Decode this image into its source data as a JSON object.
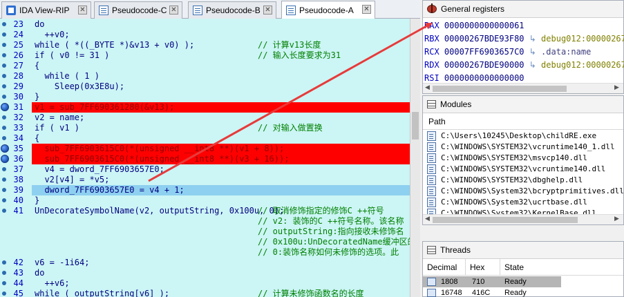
{
  "tabs": [
    {
      "label": "IDA View-RIP",
      "icon": "ida-icon",
      "active": false
    },
    {
      "label": "Pseudocode-C",
      "icon": "document-icon",
      "active": false
    },
    {
      "label": "Pseudocode-B",
      "icon": "document-icon",
      "active": false
    },
    {
      "label": "Pseudocode-A",
      "icon": "document-icon",
      "active": true
    }
  ],
  "code_lines": [
    {
      "num": "23",
      "text": "do",
      "comment": "",
      "state": "normal"
    },
    {
      "num": "24",
      "text": "  ++v0;",
      "comment": "",
      "state": "normal"
    },
    {
      "num": "25",
      "text": "while ( *((_BYTE *)&v13 + v0) );",
      "comment": "// 计算v13长度",
      "state": "normal"
    },
    {
      "num": "26",
      "text": "if ( v0 != 31 )",
      "comment": "// 输入长度要求为31",
      "state": "normal"
    },
    {
      "num": "27",
      "text": "{",
      "comment": "",
      "state": "normal"
    },
    {
      "num": "28",
      "text": "  while ( 1 )",
      "comment": "",
      "state": "normal"
    },
    {
      "num": "29",
      "text": "    Sleep(0x3E8u);",
      "comment": "",
      "state": "normal"
    },
    {
      "num": "30",
      "text": "}",
      "comment": "",
      "state": "normal"
    },
    {
      "num": "31",
      "text": "v1 = sub_7FF690361280(&v13);",
      "comment": "",
      "state": "breakpoint"
    },
    {
      "num": "32",
      "text": "v2 = name;",
      "comment": "",
      "state": "normal"
    },
    {
      "num": "33",
      "text": "if ( v1 )",
      "comment": "// 对输入做置换",
      "state": "normal"
    },
    {
      "num": "34",
      "text": "{",
      "comment": "",
      "state": "normal"
    },
    {
      "num": "35",
      "text": "  sub_7FF6903615C0(*(unsigned __int8 **)(v1 + 8));",
      "comment": "",
      "state": "breakpoint"
    },
    {
      "num": "36",
      "text": "  sub_7FF6903615C0(*(unsigned __int8 **)(v3 + 16));",
      "comment": "",
      "state": "breakpoint"
    },
    {
      "num": "37",
      "text": "  v4 = dword_7FF6903657E0;",
      "comment": "",
      "state": "normal"
    },
    {
      "num": "38",
      "text": "  v2[v4] = *v5;",
      "comment": "",
      "state": "normal"
    },
    {
      "num": "39",
      "text": "  dword_7FF6903657E0 = v4 + 1;",
      "comment": "",
      "state": "current"
    },
    {
      "num": "40",
      "text": "}",
      "comment": "",
      "state": "normal"
    },
    {
      "num": "41",
      "text": "UnDecorateSymbolName(v2, outputString, 0x100u, 0);",
      "comment": "// 取消修饰指定的修饰C ++符号",
      "state": "normal"
    },
    {
      "num": "",
      "text": "",
      "comment": "// v2: 装饰的C ++符号名称。该名称",
      "state": "normal"
    },
    {
      "num": "",
      "text": "",
      "comment": "// outputString:指向接收未修饰名",
      "state": "normal"
    },
    {
      "num": "",
      "text": "",
      "comment": "// 0x100u:UnDecoratedName缓冲区的",
      "state": "normal"
    },
    {
      "num": "",
      "text": "",
      "comment": "// 0:装饰名称如何未修饰的选项。此",
      "state": "normal"
    },
    {
      "num": "42",
      "text": "v6 = -1i64;",
      "comment": "",
      "state": "normal"
    },
    {
      "num": "43",
      "text": "do",
      "comment": "",
      "state": "normal"
    },
    {
      "num": "44",
      "text": "  ++v6;",
      "comment": "",
      "state": "normal"
    },
    {
      "num": "45",
      "text": "while ( outputString[v6] );",
      "comment": "// 计算未修饰函数名的长度",
      "state": "normal"
    }
  ],
  "registers": {
    "title": "General registers",
    "rows": [
      {
        "name": "RAX",
        "value": "0000000000000061",
        "arrow": "",
        "target": ""
      },
      {
        "name": "RBX",
        "value": "00000267BDE93F80",
        "arrow": "↳",
        "target": "debug012:00000267"
      },
      {
        "name": "RCX",
        "value": "00007FF6903657C0",
        "arrow": "↳",
        "target": ".data:name"
      },
      {
        "name": "RDX",
        "value": "00000267BDE90000",
        "arrow": "↳",
        "target": "debug012:00000267"
      },
      {
        "name": "RSI",
        "value": "0000000000000000",
        "arrow": "",
        "target": ""
      }
    ]
  },
  "modules": {
    "title": "Modules",
    "column": "Path",
    "items": [
      "C:\\Users\\10245\\Desktop\\childRE.exe",
      "C:\\WINDOWS\\SYSTEM32\\vcruntime140_1.dll",
      "C:\\WINDOWS\\SYSTEM32\\msvcp140.dll",
      "C:\\WINDOWS\\SYSTEM32\\vcruntime140.dll",
      "C:\\WINDOWS\\SYSTEM32\\dbghelp.dll",
      "C:\\WINDOWS\\System32\\bcryptprimitives.dll",
      "C:\\WINDOWS\\System32\\ucrtbase.dll",
      "C:\\WINDOWS\\System32\\KernelBase.dll"
    ]
  },
  "threads": {
    "title": "Threads",
    "columns": [
      "Decimal",
      "Hex",
      "State"
    ],
    "rows": [
      {
        "decimal": "1808",
        "hex": "710",
        "state": "Ready",
        "selected": true
      },
      {
        "decimal": "16748",
        "hex": "416C",
        "state": "Ready",
        "selected": false
      }
    ]
  },
  "colors": {
    "code_background": "#ccf5f5",
    "breakpoint_line": "#ff0000",
    "current_line": "#8ed0f0",
    "annotation_arrow": "#e83a3a"
  }
}
